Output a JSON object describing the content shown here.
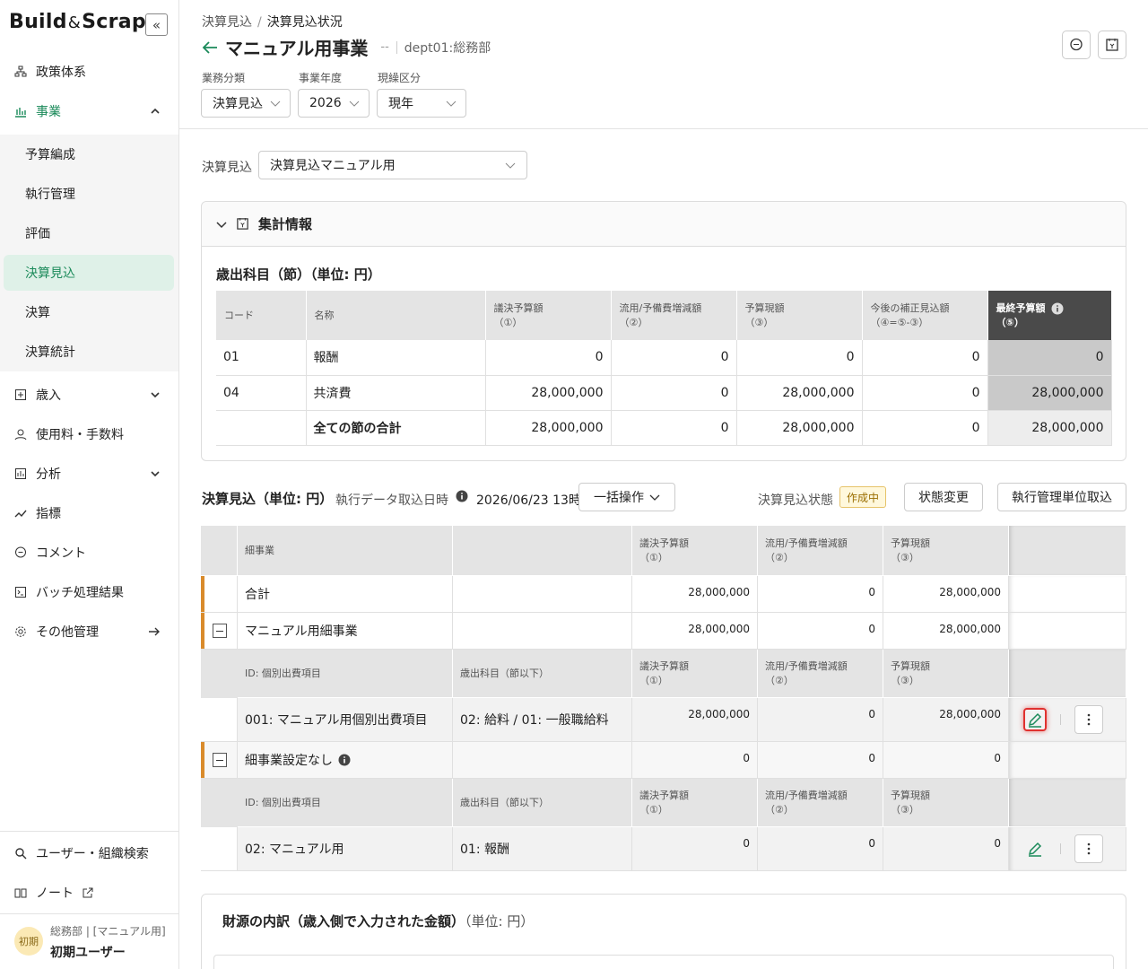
{
  "sidebar": {
    "logo": {
      "build": "Build",
      "amp": "&",
      "scrap": "Scrap"
    },
    "collapse_symbol": "«",
    "nav": [
      {
        "label": "政策体系",
        "icon": "hierarchy-icon"
      },
      {
        "label": "事業",
        "icon": "bar-chart-icon",
        "expanded": true
      },
      {
        "label": "歳入",
        "icon": "revenue-icon"
      },
      {
        "label": "使用料・手数料",
        "icon": "fee-icon"
      },
      {
        "label": "分析",
        "icon": "analysis-icon"
      },
      {
        "label": "指標",
        "icon": "trend-icon"
      },
      {
        "label": "コメント",
        "icon": "comment-icon"
      },
      {
        "label": "バッチ処理結果",
        "icon": "batch-icon"
      },
      {
        "label": "その他管理",
        "icon": "gear-icon"
      }
    ],
    "sub": [
      "予算編成",
      "執行管理",
      "評価",
      "決算見込",
      "決算",
      "決算統計"
    ],
    "bottom": [
      {
        "label": "ユーザー・組織検索",
        "icon": "search-icon"
      },
      {
        "label": "ノート",
        "icon": "note-icon"
      }
    ],
    "user": {
      "avatar": "初期",
      "dept": "総務部 | [マニュアル用]",
      "name": "初期ユーザー"
    }
  },
  "header": {
    "breadcrumb": [
      "決算見込",
      "決算見込状況"
    ],
    "breadcrumb_sep": "/",
    "title": "マニュアル用事業",
    "dash": "--",
    "dept": "dept01:総務部",
    "filters": [
      {
        "label": "業務分類",
        "value": "決算見込"
      },
      {
        "label": "事業年度",
        "value": "2026"
      },
      {
        "label": "現繰区分",
        "value": "現年"
      }
    ]
  },
  "estimate_select": {
    "label": "決算見込",
    "value": "決算見込マニュアル用"
  },
  "summary": {
    "header": "集計情報",
    "table_title": "歳出科目（節）（単位: 円）",
    "columns": [
      {
        "l1": "コード",
        "l2": ""
      },
      {
        "l1": "名称",
        "l2": ""
      },
      {
        "l1": "議決予算額",
        "l2": "（①）"
      },
      {
        "l1": "流用/予備費増減額",
        "l2": "（②）"
      },
      {
        "l1": "予算現額",
        "l2": "（③）"
      },
      {
        "l1": "今後の補正見込額",
        "l2": "（④=⑤-③）"
      },
      {
        "l1": "最終予算額",
        "l2": "（⑤）"
      }
    ],
    "rows": [
      [
        "01",
        "報酬",
        "0",
        "0",
        "0",
        "0",
        "0"
      ],
      [
        "04",
        "共済費",
        "28,000,000",
        "0",
        "28,000,000",
        "0",
        "28,000,000"
      ],
      [
        "",
        "全ての節の合計",
        "28,000,000",
        "0",
        "28,000,000",
        "0",
        "28,000,000"
      ]
    ]
  },
  "estimate": {
    "title": "決算見込（単位: 円）",
    "exec_label": "執行データ取込日時",
    "exec_date": "2026/06/23 13時",
    "bulk_button": "一括操作",
    "state_label": "決算見込状態",
    "state_badge": "作成中",
    "state_change_button": "状態変更",
    "import_button": "執行管理単位取込",
    "grid_header": [
      "細事業",
      "",
      "議決予算額",
      "（①）",
      "流用/予備費増減額",
      "（②）",
      "予算現額",
      "（③）"
    ],
    "total_row": {
      "label": "合計",
      "v1": "28,000,000",
      "v2": "0",
      "v3": "28,000,000"
    },
    "group1": {
      "label": "マニュアル用細事業",
      "v1": "28,000,000",
      "v2": "0",
      "v3": "28,000,000",
      "sub_header": [
        "ID: 個別出費項目",
        "歳出科目（節以下）",
        "議決予算額",
        "（①）",
        "流用/予備費増減額",
        "（②）",
        "予算現額",
        "（③）"
      ],
      "item": {
        "id": "001: マニュアル用個別出費項目",
        "subject": "02: 給料 / 01: 一般職給料",
        "v1": "28,000,000",
        "v2": "0",
        "v3": "28,000,000"
      }
    },
    "group2": {
      "label": "細事業設定なし",
      "v1": "0",
      "v2": "0",
      "v3": "0",
      "sub_header": [
        "ID: 個別出費項目",
        "歳出科目（節以下）",
        "議決予算額",
        "（①）",
        "流用/予備費増減額",
        "（②）",
        "予算現額",
        "（③）"
      ],
      "item": {
        "id": "02: マニュアル用",
        "subject": "01: 報酬",
        "v1": "0",
        "v2": "0",
        "v3": "0"
      }
    }
  },
  "fund": {
    "title": "財源の内訳（歳入側で入力された金額）",
    "unit": "（単位: 円）"
  },
  "colors": {
    "accent": "#1b8a5a",
    "group_marker": "#d98b2b",
    "highlight": "#e0312f",
    "badge_bg": "#fff8dc"
  }
}
